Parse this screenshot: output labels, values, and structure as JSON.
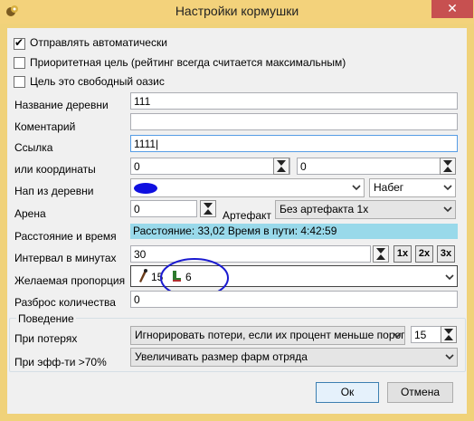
{
  "window": {
    "title": "Настройки кормушки",
    "close": "✕"
  },
  "checkboxes": [
    {
      "label": "Отправлять автоматически",
      "checked": true
    },
    {
      "label": "Приоритетная цель (рейтинг всегда считается максимальным)",
      "checked": false
    },
    {
      "label": "Цель это свободный оазис",
      "checked": false
    }
  ],
  "fields": {
    "village_name": {
      "label": "Название деревни",
      "value": "111"
    },
    "comment": {
      "label": "Коментарий",
      "value": ""
    },
    "link": {
      "label": "Ссылка",
      "value": "1111"
    },
    "coords": {
      "label": "или координаты",
      "x": "0",
      "y": "0"
    },
    "source_village": {
      "label": "Нап из деревни",
      "mode": "Набег"
    },
    "arena": {
      "label": "Арена",
      "value": "0",
      "artifact_label": "Артефакт",
      "artifact_value": "Без артефакта 1x"
    },
    "distance": {
      "label": "Расстояние и время",
      "value": "Расстояние: 33,02 Время в пути: 4:42:59"
    },
    "interval": {
      "label": "Интервал в минутах",
      "value": "30",
      "mult": [
        "1x",
        "2x",
        "3x"
      ]
    },
    "proportion": {
      "label": "Желаемая пропорция",
      "unit1_count": "15",
      "unit2_count": "6"
    },
    "spread": {
      "label": "Разброс количества",
      "value": "0"
    }
  },
  "behavior": {
    "title": "Поведение",
    "on_losses": {
      "label": "При потерях",
      "value": "Игнорировать потери, если их процент меньше порога",
      "threshold": "15"
    },
    "on_eff": {
      "label": "При эфф-ти >70%",
      "value": "Увеличивать размер фарм отряда"
    }
  },
  "buttons": {
    "ok": "Ок",
    "cancel": "Отмена"
  },
  "colors": {
    "titlebar": "#f3d27b",
    "close": "#c75050",
    "info": "#99d9ea",
    "annotation": "#1a1ad0"
  }
}
